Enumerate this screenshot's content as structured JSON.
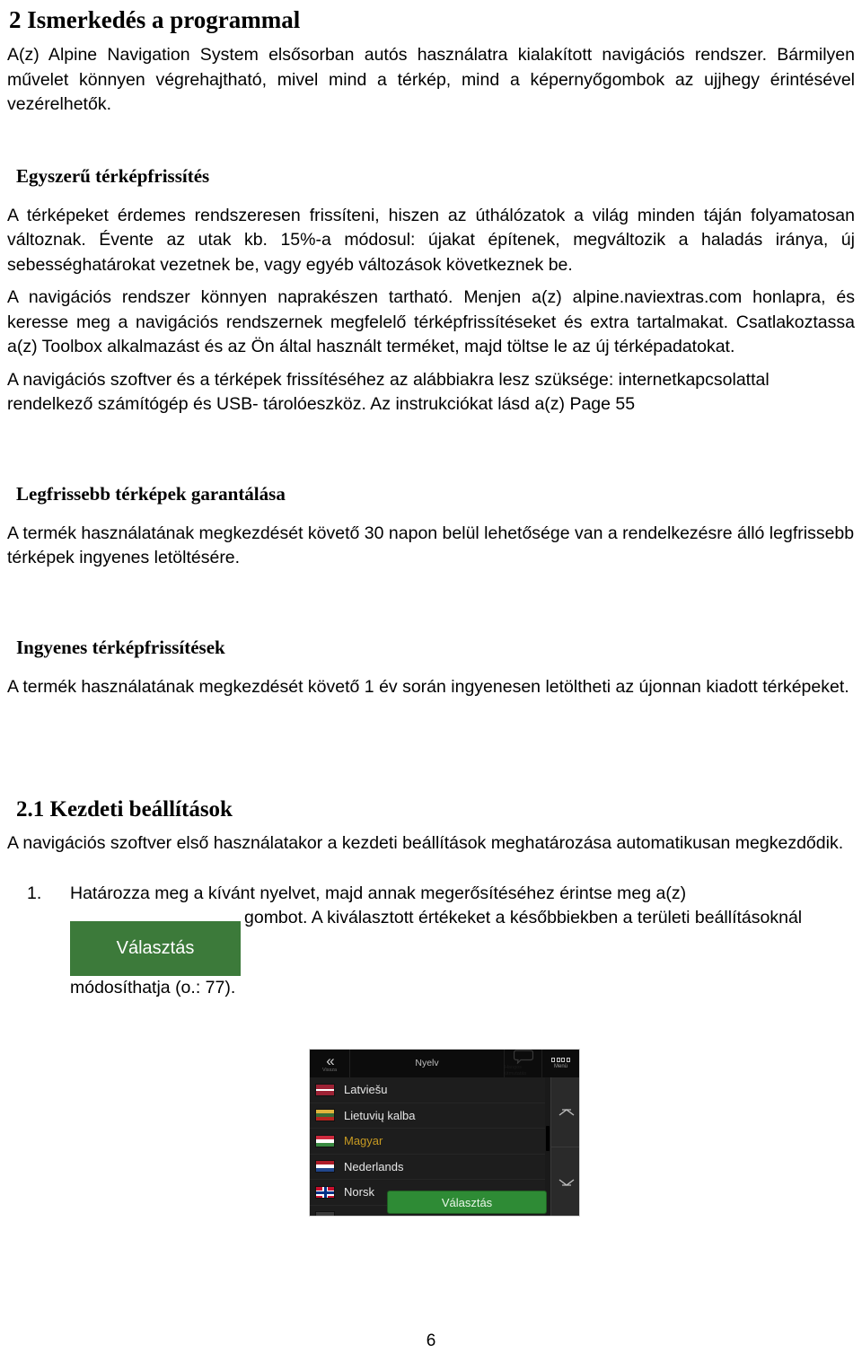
{
  "document": {
    "chapter_heading": "2 Ismerkedés a programmal",
    "intro_paragraph": "A(z) Alpine Navigation System elsősorban autós használatra kialakított navigációs rendszer. Bármilyen művelet könnyen végrehajtható, mivel mind a térkép, mind a képernyőgombok az ujjhegy érintésével vezérelhetők.",
    "sections": [
      {
        "heading": "Egyszerű térképfrissítés",
        "paragraphs": [
          "A térképeket érdemes rendszeresen frissíteni, hiszen az úthálózatok a világ minden táján folyamatosan változnak. Évente az utak kb. 15%-a módosul: újakat építenek, megváltozik a haladás iránya, új sebességhatárokat vezetnek be, vagy egyéb változások következnek be.",
          "A navigációs rendszer könnyen naprakészen tartható. Menjen a(z) alpine.naviextras.com honlapra, és keresse meg a navigációs rendszernek megfelelő térképfrissítéseket és extra tartalmakat. Csatlakoztassa a(z) Toolbox alkalmazást és az Ön által használt terméket, majd töltse le az új térképadatokat.",
          "A navigációs szoftver és a térképek frissítéséhez az alábbiakra lesz szüksége: internetkapcsolattal rendelkező számítógép és USB- tárolóeszköz. Az instrukciókat lásd a(z) Page 55"
        ]
      },
      {
        "heading": "Legfrissebb térképek garantálása",
        "paragraphs": [
          "A termék használatának megkezdését követő 30 napon  belül lehetősége van a rendelkezésre álló legfrissebb térképek ingyenes letöltésére."
        ]
      },
      {
        "heading": "Ingyenes térképfrissítések",
        "paragraphs": [
          "A termék használatának megkezdését követő  1 év során ingyenesen letöltheti az újonnan kiadott térképeket."
        ]
      }
    ],
    "section_2_1": {
      "heading": "2.1 Kezdeti beállítások",
      "paragraph": "A navigációs szoftver első használatakor a kezdeti beállítások meghatározása automatikusan megkezdődik.",
      "list": [
        {
          "number": "1.",
          "text_before": "Határozza meg a kívánt nyelvet, majd annak megerősítéséhez érintse meg a(z)",
          "button_label": "Választás",
          "text_after": "gombot. A kiválasztott értékeket a későbbiekben a területi beállításoknál módosíthatja (o.: 77)."
        }
      ]
    },
    "page_number": "6"
  },
  "device_screenshot": {
    "header": {
      "back_label": "Vissza",
      "back_icon": "chevron-double-left-icon",
      "title": "Nyelv",
      "bubble_icon": "speech-bubble-icon",
      "bubble_label": "Hangos útmutatás",
      "menu_icon": "grid-menu-icon",
      "menu_label": "Menü"
    },
    "languages": [
      {
        "label": "Latviešu",
        "flag": "flag-lv",
        "state": "normal"
      },
      {
        "label": "Lietuvių kalba",
        "flag": "flag-lt",
        "state": "normal"
      },
      {
        "label": "Magyar",
        "flag": "flag-hu",
        "state": "selected"
      },
      {
        "label": "Nederlands",
        "flag": "flag-nl",
        "state": "normal"
      },
      {
        "label": "Norsk",
        "flag": "flag-no",
        "state": "normal"
      },
      {
        "label": "",
        "flag": "flag-pl",
        "state": "partial"
      }
    ],
    "scroll_up_icon": "chevron-up-icon",
    "scroll_down_icon": "chevron-down-icon",
    "select_button_label": "Választás",
    "colors": {
      "accent_green": "#2e8b35",
      "selected_text": "#c79a22",
      "panel_bg": "#1d1d1d",
      "header_bg": "#0c0c0c"
    }
  }
}
